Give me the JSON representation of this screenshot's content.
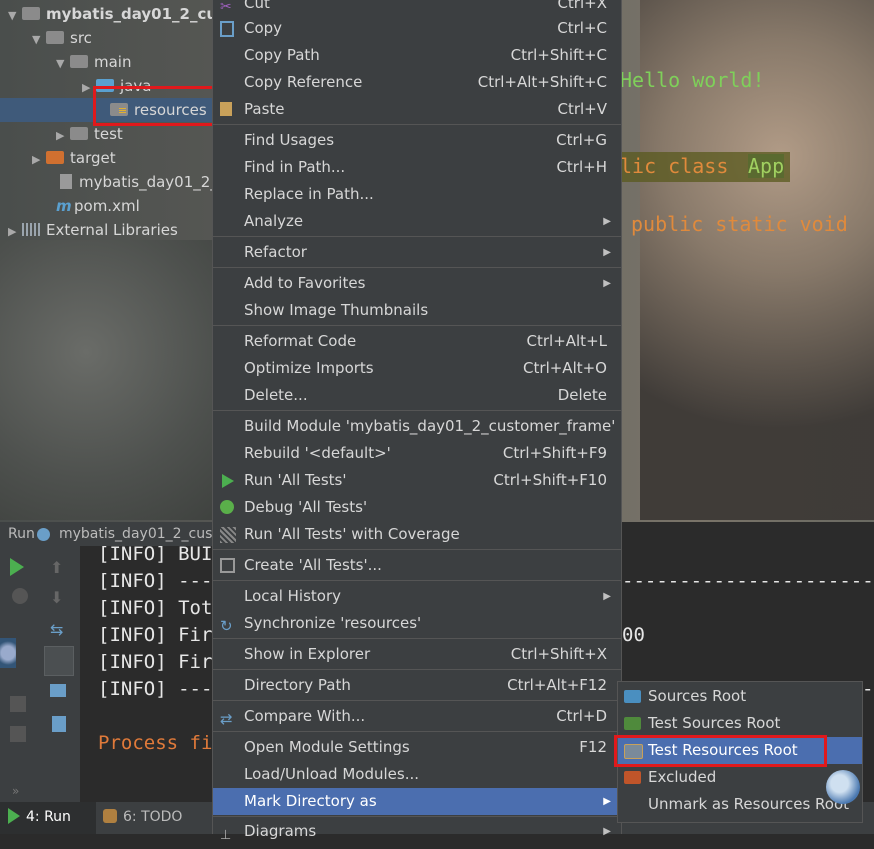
{
  "project_tree": [
    {
      "label": "mybatis_day01_2_cus",
      "indent": 0,
      "arrow": "▼",
      "icon": "module"
    },
    {
      "label": "src",
      "indent": 1,
      "arrow": "▼",
      "icon": "folder"
    },
    {
      "label": "main",
      "indent": 2,
      "arrow": "▼",
      "icon": "folder"
    },
    {
      "label": "java",
      "indent": 3,
      "arrow": "▶",
      "icon": "folder-blue"
    },
    {
      "label": "resources",
      "indent": 3,
      "arrow": "",
      "icon": "folder-resources",
      "selected": true
    },
    {
      "label": "test",
      "indent": 2,
      "arrow": "▶",
      "icon": "folder"
    },
    {
      "label": "target",
      "indent": 1,
      "arrow": "▶",
      "icon": "folder-orange"
    },
    {
      "label": "mybatis_day01_2_c",
      "indent": 1,
      "arrow": "",
      "icon": "iml-file"
    },
    {
      "label": "pom.xml",
      "indent": 1,
      "arrow": "",
      "icon": "maven-file"
    },
    {
      "label": "External Libraries",
      "indent": 0,
      "arrow": "▶",
      "icon": "libraries"
    }
  ],
  "editor": {
    "line1": "Hello world!",
    "line2_kw": "lic class ",
    "line2_name": "App",
    "line3": "public static void"
  },
  "run_panel": {
    "header_prefix": "Run",
    "header_config": "mybatis_day01_2_custom",
    "log_lines": [
      "[INFO] BUI",
      "[INFO] ---",
      "[INFO] Tot",
      "[INFO] Fir",
      "[INFO] Fir",
      "[INFO] ---",
      "",
      "Process fi"
    ],
    "right_fragment_1": "-----------------------",
    "right_fragment_2": "00",
    "right_fragment_3": "-----------------------"
  },
  "bottom_tabs": [
    {
      "label": "4: Run",
      "active": true
    },
    {
      "label": "6: TODO",
      "active": false
    }
  ],
  "context_menu": {
    "items": [
      {
        "label": "Cut",
        "shortcut": "Ctrl+X",
        "icon": "cut-icon"
      },
      {
        "label": "Copy",
        "shortcut": "Ctrl+C",
        "icon": "copy-icon"
      },
      {
        "label": "Copy Path",
        "shortcut": "Ctrl+Shift+C"
      },
      {
        "label": "Copy Reference",
        "shortcut": "Ctrl+Alt+Shift+C"
      },
      {
        "label": "Paste",
        "shortcut": "Ctrl+V",
        "icon": "paste-icon"
      },
      {
        "label": "Find Usages",
        "shortcut": "Ctrl+G"
      },
      {
        "label": "Find in Path...",
        "shortcut": "Ctrl+H"
      },
      {
        "label": "Replace in Path...",
        "shortcut": ""
      },
      {
        "label": "Analyze",
        "shortcut": "",
        "submenu": true
      },
      {
        "label": "Refactor",
        "shortcut": "",
        "submenu": true
      },
      {
        "label": "Add to Favorites",
        "shortcut": "",
        "submenu": true
      },
      {
        "label": "Show Image Thumbnails",
        "shortcut": ""
      },
      {
        "label": "Reformat Code",
        "shortcut": "Ctrl+Alt+L"
      },
      {
        "label": "Optimize Imports",
        "shortcut": "Ctrl+Alt+O"
      },
      {
        "label": "Delete...",
        "shortcut": "Delete"
      },
      {
        "label": "Build Module 'mybatis_day01_2_customer_frame'",
        "shortcut": ""
      },
      {
        "label": "Rebuild '<default>'",
        "shortcut": "Ctrl+Shift+F9"
      },
      {
        "label": "Run 'All Tests'",
        "shortcut": "Ctrl+Shift+F10",
        "icon": "run-icon"
      },
      {
        "label": "Debug 'All Tests'",
        "shortcut": "",
        "icon": "debug-icon"
      },
      {
        "label": "Run 'All Tests' with Coverage",
        "shortcut": "",
        "icon": "coverage-icon"
      },
      {
        "label": "Create 'All Tests'...",
        "shortcut": "",
        "icon": "create-test-icon"
      },
      {
        "label": "Local History",
        "shortcut": "",
        "submenu": true
      },
      {
        "label": "Synchronize 'resources'",
        "shortcut": "",
        "icon": "sync-icon"
      },
      {
        "label": "Show in Explorer",
        "shortcut": "Ctrl+Shift+X"
      },
      {
        "label": "Directory Path",
        "shortcut": "Ctrl+Alt+F12"
      },
      {
        "label": "Compare With...",
        "shortcut": "Ctrl+D",
        "icon": "compare-icon"
      },
      {
        "label": "Open Module Settings",
        "shortcut": "F12"
      },
      {
        "label": "Load/Unload Modules...",
        "shortcut": ""
      },
      {
        "label": "Mark Directory as",
        "shortcut": "",
        "submenu": true,
        "highlighted": true
      },
      {
        "label": "Diagrams",
        "shortcut": "",
        "submenu": true,
        "icon": "diagram-icon"
      }
    ]
  },
  "mark_directory_submenu": {
    "items": [
      {
        "label": "Sources Root",
        "color": "#4a8fc0"
      },
      {
        "label": "Test Sources Root",
        "color": "#4f8a3c"
      },
      {
        "label": "Test Resources Root",
        "color": "#7a8a9a",
        "highlighted": true
      },
      {
        "label": "Excluded",
        "color": "#c0552a"
      },
      {
        "label": "Unmark as Resources Root",
        "color": ""
      }
    ]
  },
  "colors": {
    "menu_bg": "#3c3f41",
    "highlight": "#4b6eaf",
    "annotation_red": "#e0191c"
  }
}
